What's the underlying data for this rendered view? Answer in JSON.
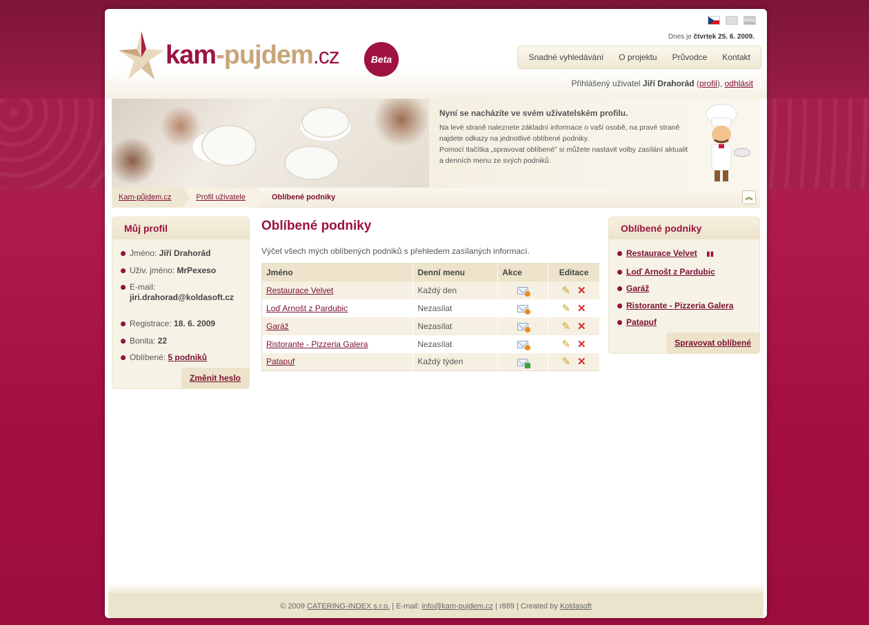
{
  "header": {
    "logo_part1": "kam",
    "logo_dash": "-",
    "logo_part2": "pujdem",
    "logo_tld": ".cz",
    "beta": "Beta",
    "date_prefix": "Dnes je",
    "date_value": "čtvrtek 25. 6. 2009.",
    "nav": [
      "Snadné vyhledávání",
      "O projektu",
      "Průvodce",
      "Kontakt"
    ],
    "user_prefix": "Přihlášený uživatel",
    "user_name": "Jiří Drahorád",
    "profile_link": "profil",
    "logout_link": "odhlásit"
  },
  "banner": {
    "title": "Nyní se nacházíte ve svém uživatelském profilu.",
    "text1": "Na levé straně naleznete základní informace o vaší osobě, na pravé straně najdete odkazy na jednotlivé oblíbené podniky.",
    "text2": "Pomocí tlačítka „spravovat oblíbené\" si můžete nastavit volby zasílání aktualit a denních menu ze svých podniků."
  },
  "breadcrumb": [
    "Kam-půjdem.cz",
    "Profil uživatele",
    "Oblíbené podniky"
  ],
  "profile": {
    "title": "Můj profil",
    "name_label": "Jméno:",
    "name": "Jiří Drahorád",
    "username_label": "Uživ. jméno:",
    "username": "MrPexeso",
    "email_label": "E-mail:",
    "email": "jiri.drahorad@koldasoft.cz",
    "reg_label": "Registrace:",
    "reg": "18. 6. 2009",
    "bonita_label": "Bonita:",
    "bonita": "22",
    "fav_label": "Oblíbené:",
    "fav": "5 podniků",
    "change_password": "Změnit heslo"
  },
  "main": {
    "title": "Oblíbené podniky",
    "lead": "Výčet všech mých oblíbených podniků s přehledem zasílaných informací.",
    "columns": [
      "Jméno",
      "Denní menu",
      "Akce",
      "Editace"
    ],
    "rows": [
      {
        "name": "Restaurace Velvet",
        "menu": "Každý den"
      },
      {
        "name": "Loď Arnošt z Pardubic",
        "menu": "Nezasílat"
      },
      {
        "name": "Garáž",
        "menu": "Nezasílat"
      },
      {
        "name": "Ristorante - Pizzeria Galera",
        "menu": "Nezasílat"
      },
      {
        "name": "Patapuf",
        "menu": "Každý týden"
      }
    ]
  },
  "favorites": {
    "title": "Oblíbené podniky",
    "items": [
      "Restaurace Velvet",
      "Loď Arnošt z Pardubic",
      "Garáž",
      "Ristorante - Pizzeria Galera",
      "Patapuf"
    ],
    "manage": "Spravovat oblíbené"
  },
  "footer": {
    "copy": "© 2009",
    "company": "CATERING-INDEX s.r.o.",
    "email_label": "| E-mail:",
    "email": "info@kam-pujdem.cz",
    "rev": "| r889 | Created by",
    "author": "Koldasoft"
  }
}
